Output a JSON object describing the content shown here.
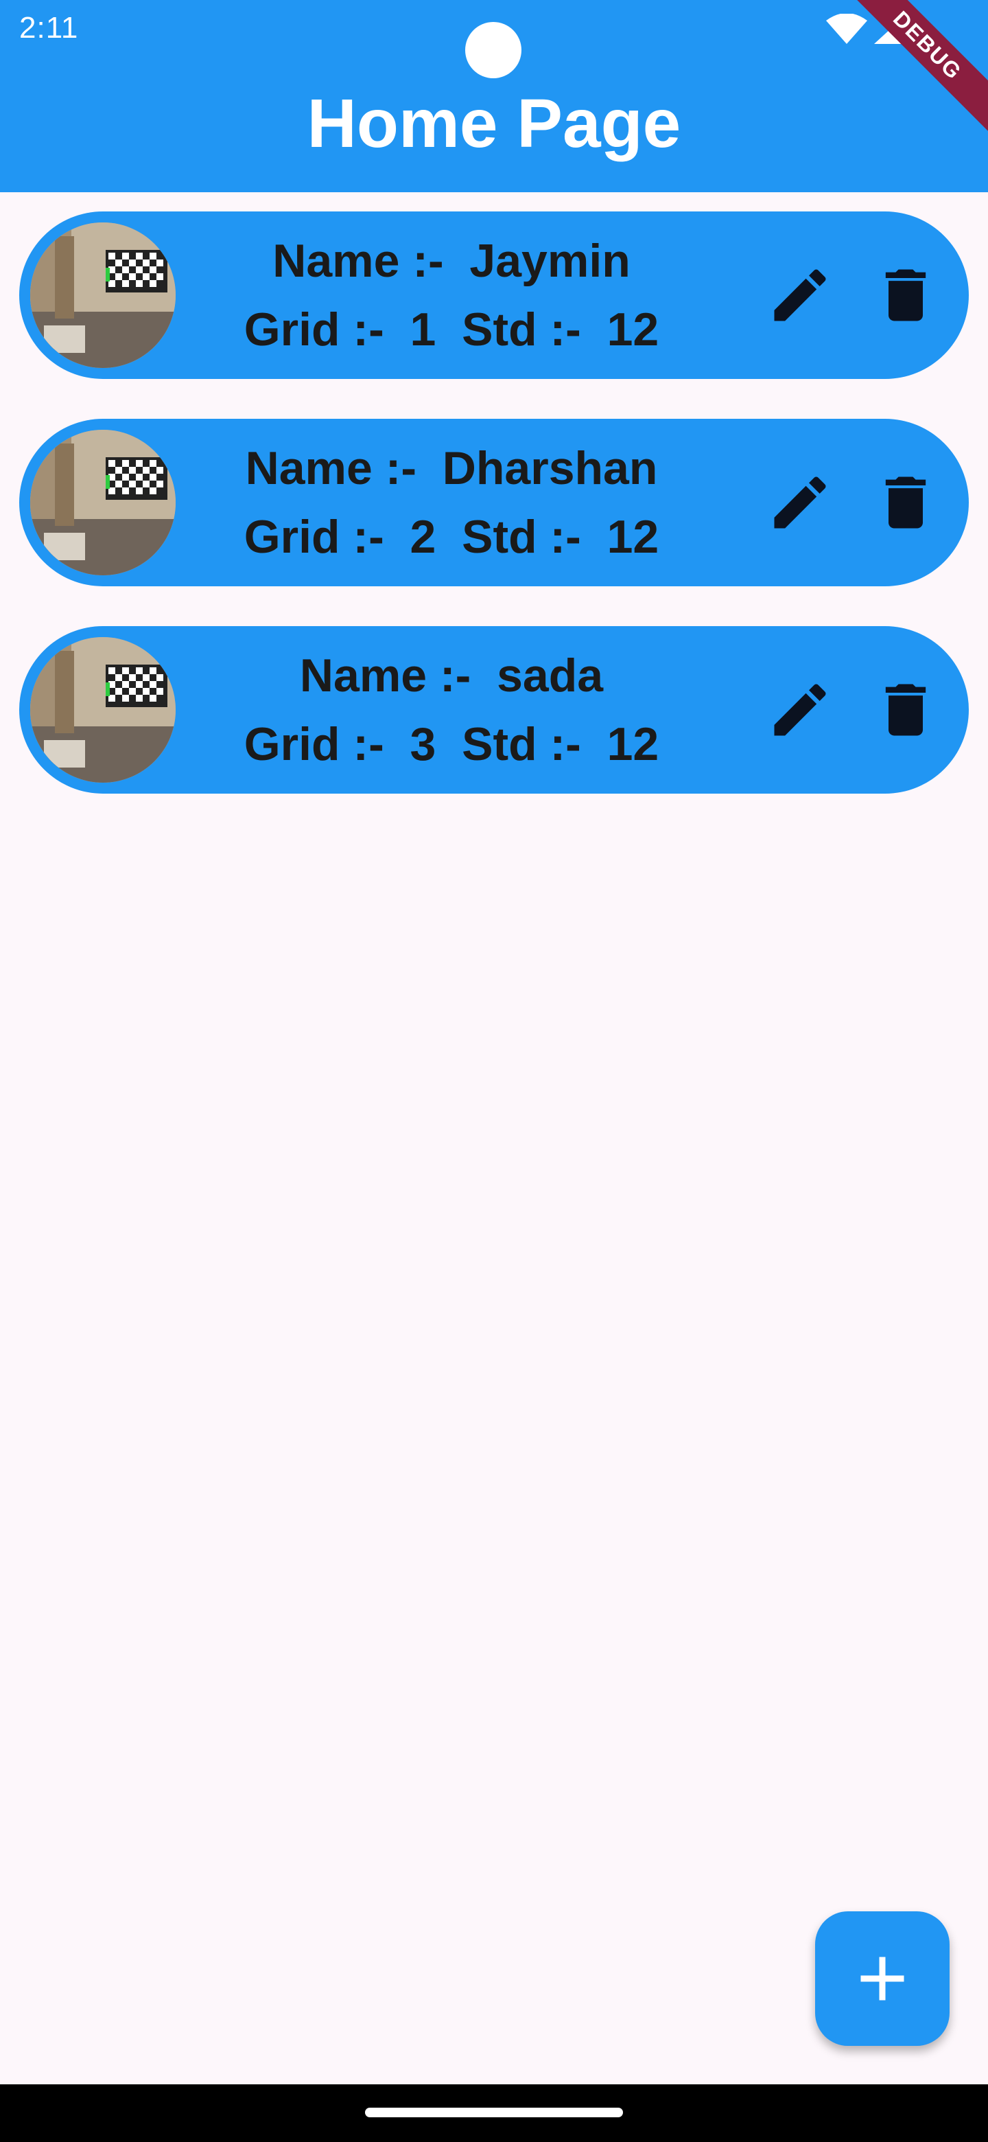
{
  "status_bar": {
    "time": "2:11",
    "icons": [
      "wifi-icon",
      "signal-icon"
    ]
  },
  "app_bar": {
    "title": "Home Page",
    "background": "#2196f3"
  },
  "debug_banner": "DEBUG",
  "students": [
    {
      "name_line": "Name :-  Jaymin",
      "grid_line": "Grid :-  1  Std :-  12"
    },
    {
      "name_line": "Name :-  Dharshan",
      "grid_line": "Grid :-  2  Std :-  12"
    },
    {
      "name_line": "Name :-  sada",
      "grid_line": "Grid :-  3  Std :-  12"
    }
  ],
  "card_icons": [
    "avatar",
    "edit-icon",
    "delete-icon"
  ],
  "fab_icon": "add-icon",
  "colors": {
    "accent": "#2196f3",
    "text": "#1a1a1a",
    "icon": "#0b1220",
    "background": "#fdf7fb",
    "debug": "#8b1e3f"
  }
}
